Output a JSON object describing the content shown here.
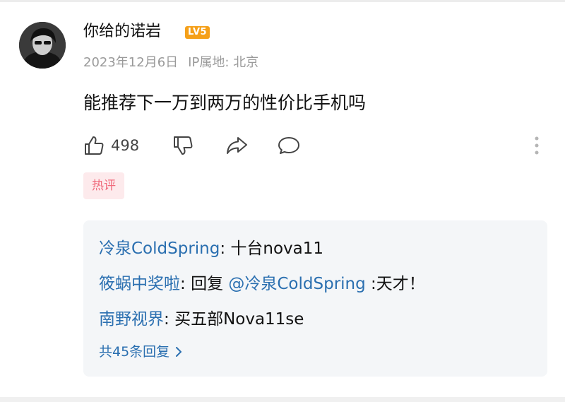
{
  "comment": {
    "username": "你给的诺岩",
    "level_badge": "LV5",
    "date": "2023年12月6日",
    "ip_location": "IP属地: 北京",
    "text": "能推荐下一万到两万的性价比手机吗",
    "like_count": "498",
    "hot_tag": "热评"
  },
  "icons": {
    "like": "thumbs-up-icon",
    "dislike": "thumbs-down-icon",
    "share": "share-icon",
    "reply": "comment-icon",
    "more": "more-vertical-icon",
    "expand": "chevron-right-icon"
  },
  "replies": [
    {
      "author": "冷泉ColdSpring",
      "separator": ": ",
      "text": "十台nova11"
    },
    {
      "author": "筱蜗中奖啦",
      "separator": ": ",
      "prefix": "回复 ",
      "mention": "@冷泉ColdSpring",
      "text": " :天才！"
    },
    {
      "author": "南野视界",
      "separator": ": ",
      "text": "买五部Nova11se"
    }
  ],
  "more_replies_label": "共45条回复",
  "colors": {
    "link_blue": "#2a6fb0",
    "hot_tag_text": "#f06b7c",
    "hot_tag_bg": "#fdeaec",
    "badge_orange": "#f5a01a",
    "meta_gray": "#9a9a9a",
    "reply_box_bg": "#f4f6f8"
  }
}
